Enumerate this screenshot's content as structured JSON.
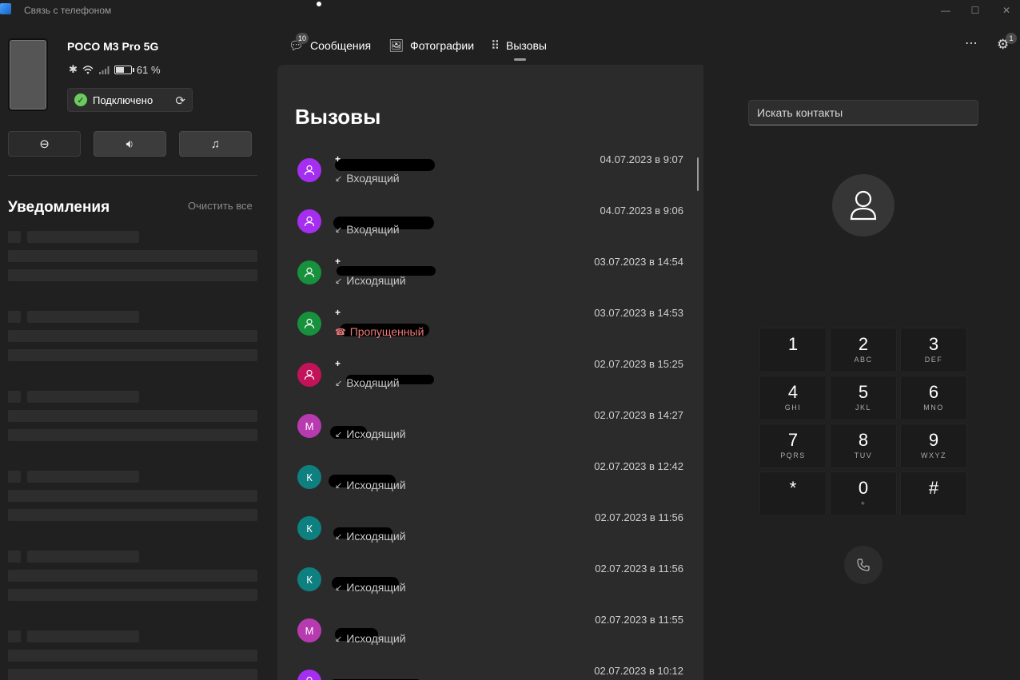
{
  "window": {
    "title": "Связь с телефоном",
    "minimize": "—",
    "maximize": "☐",
    "close": "✕"
  },
  "device": {
    "name": "POCO M3 Pro 5G",
    "battery_text": "61 %",
    "battery_fraction": 0.61,
    "connection_label": "Подключено"
  },
  "notifications": {
    "title": "Уведомления",
    "clear_all": "Очистить все"
  },
  "nav": {
    "messages_label": "Сообщения",
    "messages_badge": "10",
    "photos_label": "Фотографии",
    "calls_label": "Вызовы",
    "settings_badge": "1"
  },
  "calls": {
    "title": "Вызовы",
    "items": [
      {
        "avatar": "",
        "avatar_color": "#a52ef0",
        "plus": "+",
        "type": "Входящий",
        "missed": false,
        "date": "04.07.2023 в 9:07"
      },
      {
        "avatar": "",
        "avatar_color": "#a52ef0",
        "plus": "",
        "type": "Входящий",
        "missed": false,
        "date": "04.07.2023 в 9:06"
      },
      {
        "avatar": "",
        "avatar_color": "#17913c",
        "plus": "+",
        "type": "Исходящий",
        "missed": false,
        "date": "03.07.2023 в 14:54"
      },
      {
        "avatar": "",
        "avatar_color": "#17913c",
        "plus": "+",
        "type": "Пропущенный",
        "missed": true,
        "date": "03.07.2023 в 14:53"
      },
      {
        "avatar": "",
        "avatar_color": "#c2135a",
        "plus": "+",
        "type": "Входящий",
        "missed": false,
        "date": "02.07.2023 в 15:25"
      },
      {
        "avatar": "М",
        "avatar_color": "#b83ab0",
        "plus": "",
        "type": "Исходящий",
        "missed": false,
        "date": "02.07.2023 в 14:27"
      },
      {
        "avatar": "К",
        "avatar_color": "#0f8080",
        "plus": "",
        "type": "Исходящий",
        "missed": false,
        "date": "02.07.2023 в 12:42"
      },
      {
        "avatar": "К",
        "avatar_color": "#0f8080",
        "plus": "",
        "type": "Исходящий",
        "missed": false,
        "date": "02.07.2023 в 11:56"
      },
      {
        "avatar": "К",
        "avatar_color": "#0f8080",
        "plus": "",
        "type": "Исходящий",
        "missed": false,
        "date": "02.07.2023 в 11:56"
      },
      {
        "avatar": "М",
        "avatar_color": "#b83ab0",
        "plus": "",
        "type": "Исходящий",
        "missed": false,
        "date": "02.07.2023 в 11:55"
      },
      {
        "avatar": "",
        "avatar_color": "#a52ef0",
        "plus": "",
        "type": "",
        "missed": false,
        "date": "02.07.2023 в 10:12"
      }
    ]
  },
  "dialer": {
    "search_placeholder": "Искать контакты",
    "keys": [
      {
        "digit": "1",
        "letters": ""
      },
      {
        "digit": "2",
        "letters": "ABC"
      },
      {
        "digit": "3",
        "letters": "DEF"
      },
      {
        "digit": "4",
        "letters": "GHI"
      },
      {
        "digit": "5",
        "letters": "JKL"
      },
      {
        "digit": "6",
        "letters": "MNO"
      },
      {
        "digit": "7",
        "letters": "PQRS"
      },
      {
        "digit": "8",
        "letters": "TUV"
      },
      {
        "digit": "9",
        "letters": "WXYZ"
      },
      {
        "digit": "*",
        "letters": ""
      },
      {
        "digit": "0",
        "letters": "+"
      },
      {
        "digit": "#",
        "letters": ""
      }
    ]
  },
  "icons": {
    "call_icon": "phone-icon",
    "settings_icon": "gear-icon",
    "more_icon": "more-icon"
  }
}
